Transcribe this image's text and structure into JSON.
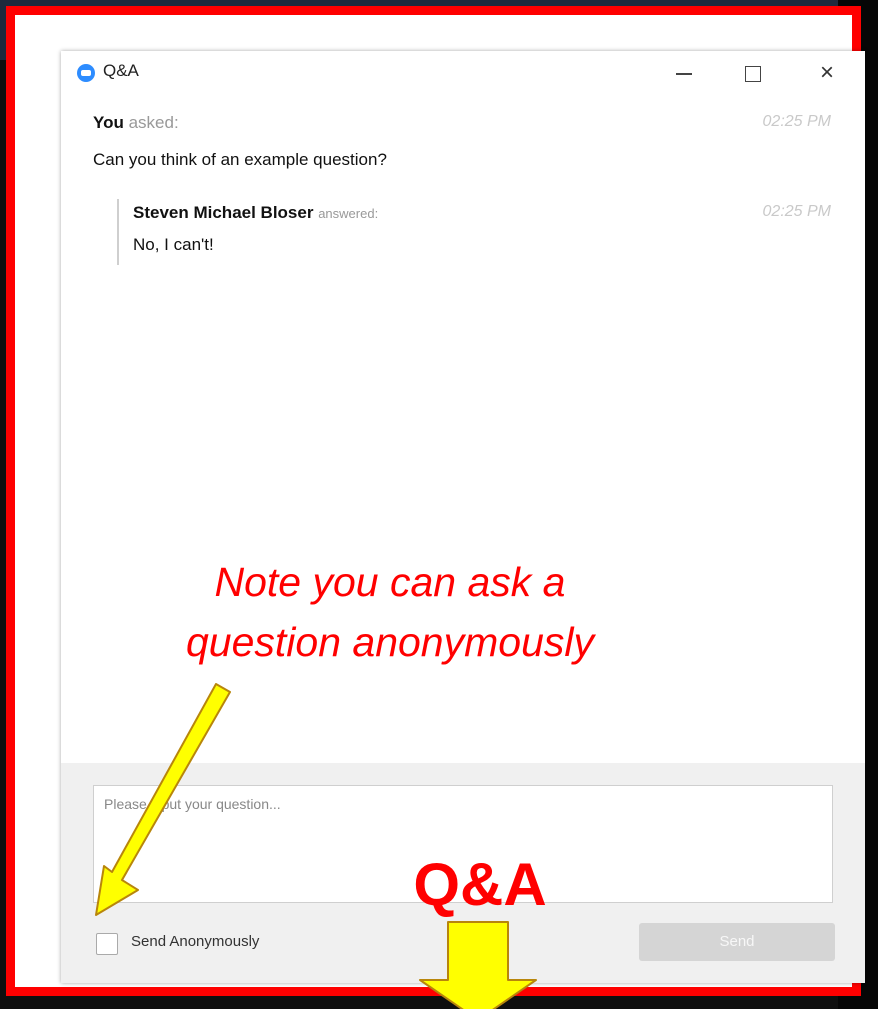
{
  "window": {
    "title": "Q&A",
    "controls": {
      "minimize": "minimize",
      "maximize": "maximize",
      "close": "×"
    }
  },
  "question": {
    "author": "You",
    "verb": "asked:",
    "time": "02:25 PM",
    "text": "Can you think of an example question?"
  },
  "answer": {
    "author": "Steven Michael Bloser",
    "verb": "answered:",
    "time": "02:25 PM",
    "text": "No, I can't!"
  },
  "composer": {
    "placeholder": "Please input your question...",
    "anonymous_label": "Send Anonymously",
    "send_label": "Send"
  },
  "annotations": {
    "note_line1": "Note you can ask a",
    "note_line2": "question anonymously",
    "label": "Q&A"
  },
  "colors": {
    "accent": "#2d8cff",
    "annotation_red": "#ff0000",
    "annotation_yellow": "#ffff00"
  }
}
